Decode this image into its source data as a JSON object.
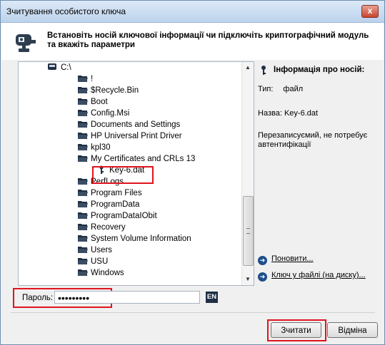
{
  "window": {
    "title": "Зчитування особистого ключа",
    "close_label": "x"
  },
  "header": {
    "text": "Встановіть носій ключової інформації чи підключіть криптографічний модуль та вкажіть параметри",
    "icon": "key-device-icon"
  },
  "tree": {
    "root": "C:\\",
    "items": [
      "!",
      "$Recycle.Bin",
      "Boot",
      "Config.Msi",
      "Documents and Settings",
      "HP Universal Print Driver",
      "kpl30",
      "My Certificates and CRLs 13"
    ],
    "selected_file": "Key-6.dat",
    "items_after": [
      "PerfLogs",
      "Program Files",
      "ProgramData",
      "ProgramDataIObit",
      "Recovery",
      "System Volume Information",
      "Users",
      "USU",
      "Windows"
    ]
  },
  "info": {
    "title": "Інформація про носій:",
    "type_label": "Тип:",
    "type_value": "файл",
    "name_label": "Назва:",
    "name_value": "Key-6.dat",
    "description": "Перезаписуємий, не потребує автентифікації",
    "refresh_link": "Поновити...",
    "file_key_link": "Ключ у файлі (на диску)..."
  },
  "password": {
    "label": "Пароль:",
    "value": "•••••••••",
    "lang": "EN"
  },
  "buttons": {
    "read": "Зчитати",
    "cancel": "Відміна"
  },
  "colors": {
    "highlight": "#e0141e",
    "title_bar": "#bcd2ec",
    "lang_badge": "#1f2f44"
  }
}
